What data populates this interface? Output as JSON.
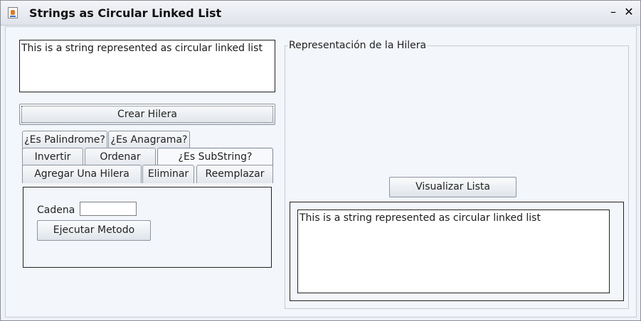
{
  "window": {
    "title": "Strings as Circular Linked List",
    "minimize_glyph": "–",
    "close_glyph": "✕"
  },
  "left": {
    "input_text": "This is a string represented as circular linked list",
    "create_button": "Crear Hilera",
    "tabs_row1": [
      "¿Es Palindrome?",
      "¿Es Anagrama?"
    ],
    "tabs_row2": [
      "Invertir",
      "Ordenar",
      "¿Es SubString?"
    ],
    "tabs_row3": [
      "Agregar Una Hilera",
      "Eliminar",
      "Reemplazar"
    ],
    "selected_tab": "¿Es SubString?",
    "panel": {
      "cadena_label": "Cadena",
      "cadena_value": "",
      "run_button": "Ejecutar Metodo"
    }
  },
  "right": {
    "group_title": "Representación de la Hilera",
    "visualize_button": "Visualizar Lista",
    "output_text": "This is a string represented as circular linked list"
  }
}
